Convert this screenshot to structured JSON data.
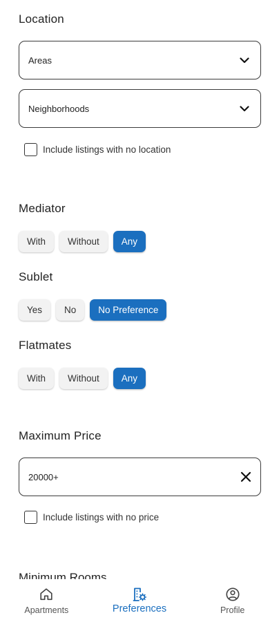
{
  "location": {
    "title": "Location",
    "areas_value": "Areas",
    "neighborhoods_value": "Neighborhoods",
    "no_location_label": "Include listings with no location"
  },
  "mediator": {
    "title": "Mediator",
    "options": [
      "With",
      "Without",
      "Any"
    ],
    "selected": "Any"
  },
  "sublet": {
    "title": "Sublet",
    "options": [
      "Yes",
      "No",
      "No Preference"
    ],
    "selected": "No Preference"
  },
  "flatmates": {
    "title": "Flatmates",
    "options": [
      "With",
      "Without",
      "Any"
    ],
    "selected": "Any"
  },
  "price": {
    "title": "Maximum Price",
    "value": "20000+",
    "no_price_label": "Include listings with no price"
  },
  "rooms": {
    "title": "Minimum Rooms"
  },
  "nav": {
    "items": [
      "Apartments",
      "Preferences",
      "Profile"
    ],
    "active": "Preferences"
  },
  "colors": {
    "accent": "#1b6fbf",
    "chip_bg": "#f2f2f2"
  }
}
